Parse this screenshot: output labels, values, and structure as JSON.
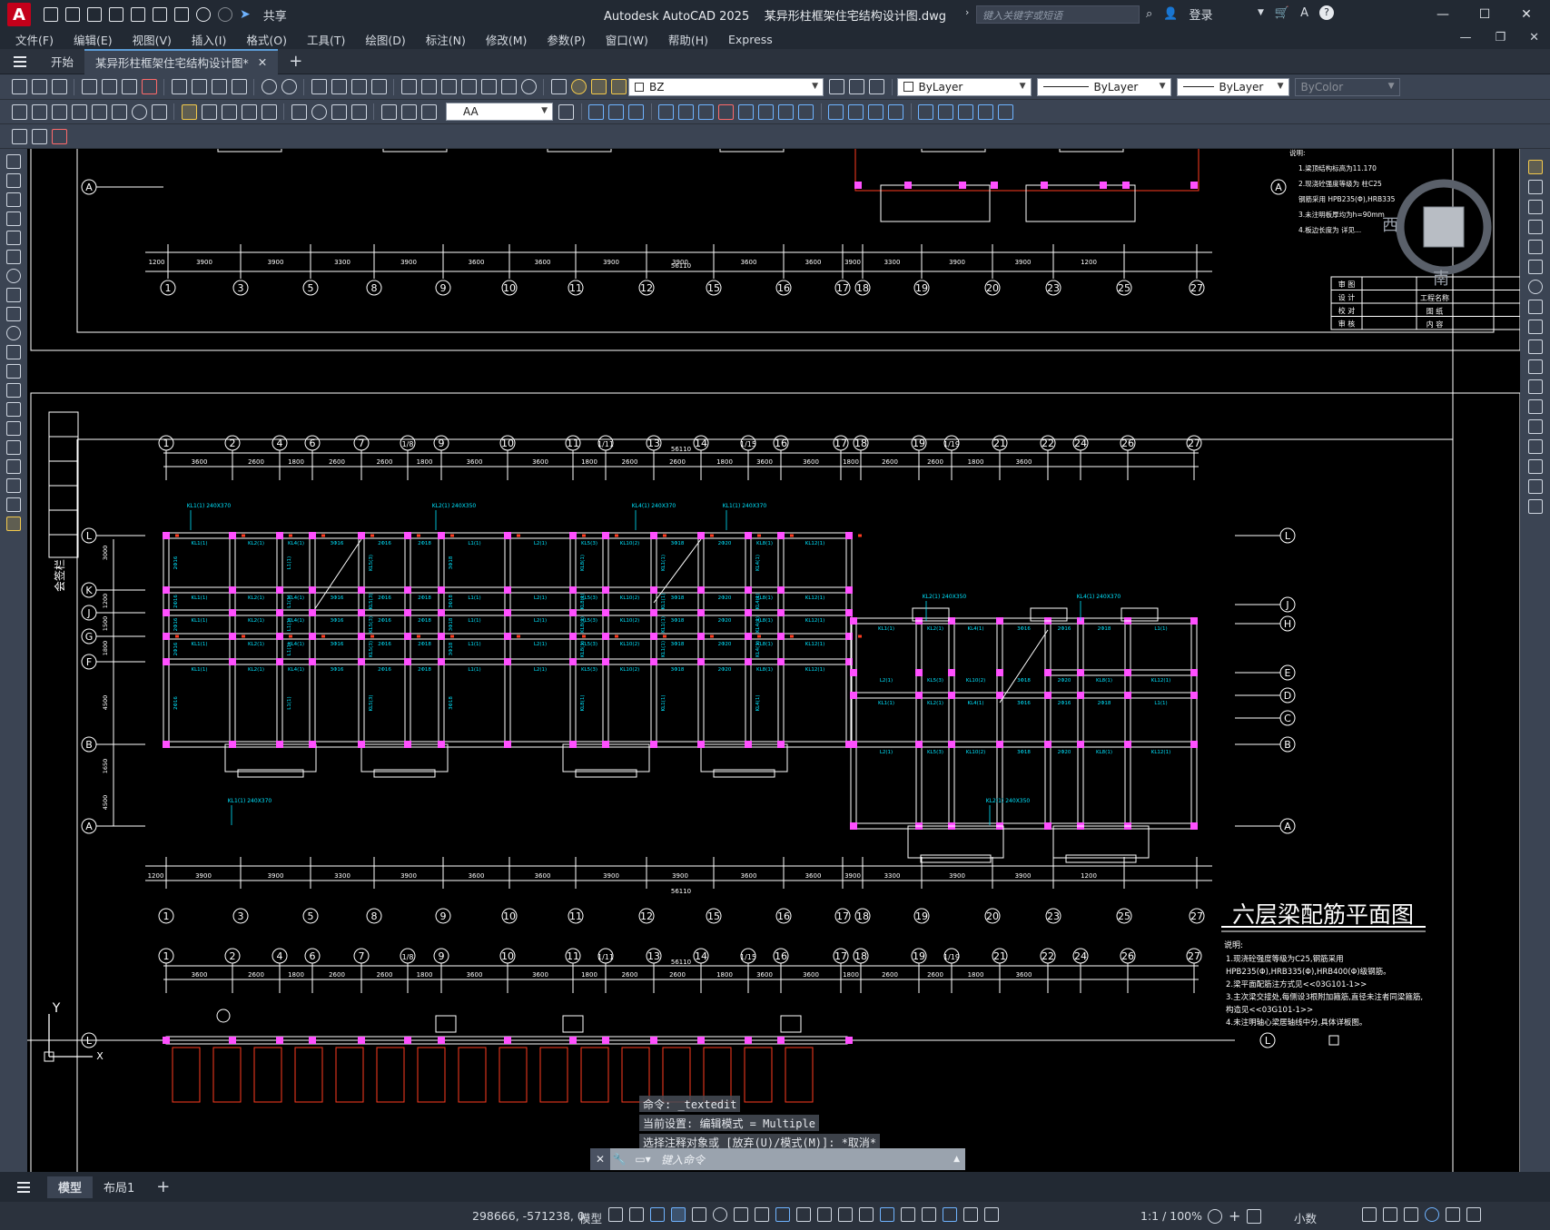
{
  "titlebar": {
    "app_title": "Autodesk AutoCAD 2025",
    "file_name": "某异形柱框架住宅结构设计图.dwg",
    "share_label": "共享",
    "search_placeholder": "键入关键字或短语",
    "login_label": "登录",
    "logo_letter": "A"
  },
  "menu": {
    "items": [
      "文件(F)",
      "编辑(E)",
      "视图(V)",
      "插入(I)",
      "格式(O)",
      "工具(T)",
      "绘图(D)",
      "标注(N)",
      "修改(M)",
      "参数(P)",
      "窗口(W)",
      "帮助(H)",
      "Express"
    ]
  },
  "tabs": {
    "start": "开始",
    "drawing": "某异形柱框架住宅结构设计图*"
  },
  "toolbar": {
    "layer_name": "BZ",
    "color": "ByLayer",
    "linetype": "ByLayer",
    "lineweight": "ByLayer",
    "plotstyle": "ByColor",
    "text_style": "AA"
  },
  "viewcube": {
    "west": "西",
    "south": "南"
  },
  "drawing": {
    "title": "六层梁配筋平面图",
    "notes_heading": "说明:",
    "notes": [
      "1.现浇砼强度等级为C25,钢筋采用",
      "HPB235(Φ),HRB335(Φ),HRB400(Φ)级钢筋。",
      "2.梁平面配筋注方式见<<03G101-1>>",
      "3.主次梁交接处,每侧设3根附加箍筋,直径未注者同梁箍筋,",
      "构造见<<03G101-1>>",
      "4.未注明轴心梁居轴线中分,具体详板图。"
    ],
    "top_notes": [
      "说明:",
      "1.梁顶结构标高为11.170",
      "2.现浇砼强度等级为 柱C25",
      "钢筋采用 HPB235(Φ),HRB335",
      "3.未注明板厚均为h=90mm",
      "4.板边长度为 详见..."
    ],
    "side_label": "会签栏",
    "axis_top": [
      "1",
      "3",
      "5",
      "8",
      "9",
      "10",
      "11",
      "12",
      "15",
      "16",
      "17",
      "18",
      "19",
      "20",
      "23",
      "25",
      "27"
    ],
    "axis_mid": [
      "1",
      "2",
      "4",
      "6",
      "7",
      "1/8",
      "9",
      "10",
      "11",
      "1/11",
      "13",
      "14",
      "1/15",
      "16",
      "17",
      "18",
      "19",
      "1/19",
      "21",
      "22",
      "24",
      "26",
      "27"
    ],
    "axis_rows_left": [
      "L",
      "K",
      "J",
      "G",
      "F",
      "B",
      "A"
    ],
    "axis_rows_right": [
      "L",
      "J",
      "H",
      "E",
      "D",
      "C",
      "B",
      "A"
    ],
    "total_dim": "56110",
    "dims_top": [
      "1200",
      "3900",
      "3900",
      "3300",
      "3900",
      "3600",
      "3600",
      "3900",
      "3900",
      "3600",
      "3600",
      "3900",
      "3300",
      "3900",
      "3900",
      "1200"
    ],
    "dims_mid": [
      "3600",
      "2600",
      "1800",
      "2600",
      "2600",
      "1800",
      "3600",
      "3600",
      "1800",
      "2600",
      "2600",
      "1800",
      "3600",
      "3600",
      "1800",
      "2600",
      "2600",
      "1800",
      "3600"
    ],
    "row_dims": [
      "3000",
      "1200",
      "1500",
      "1800",
      "4500",
      "1650",
      "4500"
    ],
    "title_block": [
      "审 图",
      "设 计",
      "校 对",
      "审 核"
    ],
    "title_block_right": [
      "工程名称",
      "图 纸",
      "内 容"
    ],
    "ucs_y": "Y",
    "ucs_x": "X"
  },
  "command": {
    "lines": [
      "命令: _textedit",
      "当前设置: 编辑模式 = Multiple",
      "选择注释对象或 [放弃(U)/模式(M)]: *取消*"
    ],
    "input_placeholder": "键入命令"
  },
  "layout_tabs": {
    "model": "模型",
    "layout1": "布局1"
  },
  "status": {
    "coords": "298666, -571238, 0",
    "model": "模型",
    "scale": "1:1 / 100%",
    "units": "小数"
  },
  "colors": {
    "column": "#ff50ff",
    "beam": "#ffffff",
    "rebar_text": "#00e5ff",
    "dim": "#ffffff",
    "red_line": "#ff3b1f",
    "accent": "#5b9bd5"
  }
}
